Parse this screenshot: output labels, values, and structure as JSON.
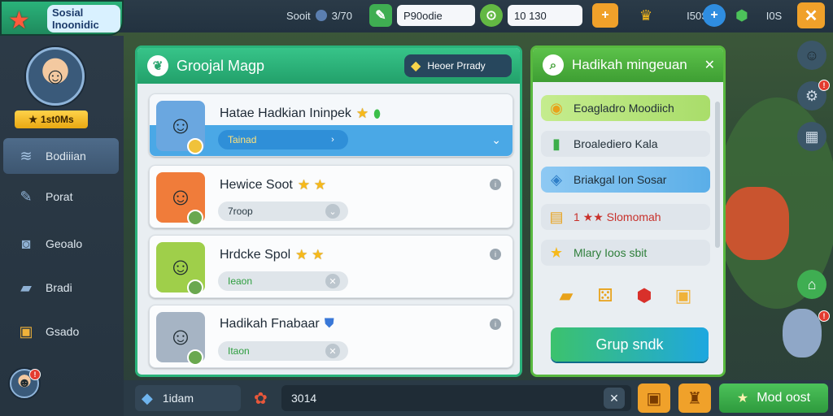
{
  "header": {
    "logo_title": "Sosial Inoonidic",
    "stat1_label": "Sooit",
    "stat1_value": "3/70",
    "cash_value": "P90odie",
    "coins_value": "10 130",
    "stat3_value": "I50S",
    "stat4_value": "I0S"
  },
  "sidebar": {
    "level_label": "1st0Ms",
    "items": [
      {
        "label": "Bodiiian"
      },
      {
        "label": "Porat"
      },
      {
        "label": "Geoalo"
      },
      {
        "label": "Bradi"
      },
      {
        "label": "Gsado"
      }
    ]
  },
  "main": {
    "title": "Groojal Magp",
    "header_button": "Heoer Prrady",
    "cards": [
      {
        "name": "Hatae Hadkian Ininpek",
        "sub": "Tainad",
        "stars": "★",
        "selected": true
      },
      {
        "name": "Hewice Soot",
        "sub": "7roop",
        "stars": "★ ★"
      },
      {
        "name": "Hrdcke Spol",
        "sub": "Ieaon",
        "stars": "★ ★"
      },
      {
        "name": "Hadikah Fnabaar",
        "sub": "Itaon",
        "stars": ""
      }
    ]
  },
  "right_panel": {
    "title": "Hadikah mingeuan",
    "items": [
      {
        "label": "Eoagladro Moodiich"
      },
      {
        "label": "Broalediero Kala"
      },
      {
        "label": "Briakgal Ion Sosar"
      },
      {
        "label": "1 ★★ Slomomah"
      },
      {
        "label": "Mlary Ioos sbit"
      }
    ],
    "button": "Grup sndk"
  },
  "bottom": {
    "left_label": "1idam",
    "value": "3014",
    "action_button": "Mod oost"
  },
  "colors": {
    "accent_green": "#2ab37a",
    "panel_border_right": "#58b83f",
    "selected_blue": "#4aa8e6",
    "star_gold": "#f6b91b"
  }
}
